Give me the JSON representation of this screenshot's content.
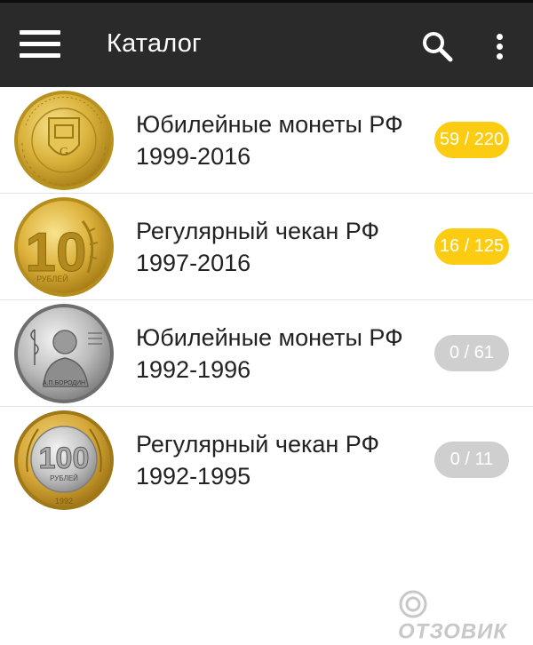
{
  "app_bar": {
    "title": "Каталог",
    "menu_icon": "hamburger-menu-icon",
    "search_icon": "search-icon",
    "more_icon": "more-vert-icon"
  },
  "catalog": [
    {
      "title_line1": "Юбилейные монеты РФ",
      "title_line2": "1999-2016",
      "count": "59 / 220",
      "state": "active",
      "coin": "gatchina-10-rub-coin"
    },
    {
      "title_line1": "Регулярный чекан РФ",
      "title_line2": "1997-2016",
      "count": "16 / 125",
      "state": "active",
      "coin": "10-rub-coin"
    },
    {
      "title_line1": "Юбилейные монеты РФ",
      "title_line2": "1992-1996",
      "count": "0 / 61",
      "state": "inactive",
      "coin": "borodin-silver-coin",
      "coin_text": "А.П.БОРОДИН"
    },
    {
      "title_line1": "Регулярный чекан РФ",
      "title_line2": "1992-1995",
      "count": "0 / 11",
      "state": "inactive",
      "coin": "100-rub-bimetal-coin",
      "coin_value": "100",
      "coin_text": "РУБЛЕЙ",
      "coin_year": "1992"
    }
  ],
  "watermark": {
    "text": "ОТЗОВИК",
    "icon": "otzovik-logo-icon"
  },
  "colors": {
    "app_bar": "#2a2a2a",
    "badge_active": "#fbcc11",
    "badge_inactive": "#cfcfcf"
  }
}
